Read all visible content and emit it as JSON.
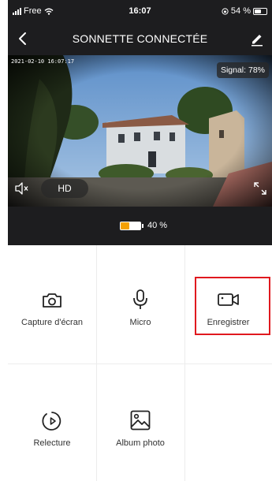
{
  "status_bar": {
    "carrier": "Free",
    "time": "16:07",
    "battery_percent": "54 %"
  },
  "header": {
    "title": "SONNETTE CONNECTÉE"
  },
  "video": {
    "timestamp": "2021-02-10 16:07:17",
    "signal": "Signal: 78%",
    "quality": "HD"
  },
  "battery": {
    "percent_label": "40 %",
    "level": 0.4,
    "fill_color": "#f5a000"
  },
  "actions": [
    {
      "label": "Capture d'écran",
      "icon": "camera-icon"
    },
    {
      "label": "Micro",
      "icon": "microphone-icon"
    },
    {
      "label": "Enregistrer",
      "icon": "video-camera-icon"
    },
    {
      "label": "Relecture",
      "icon": "playback-icon"
    },
    {
      "label": "Album photo",
      "icon": "photo-album-icon"
    }
  ],
  "colors": {
    "dark_bg": "#1d1d1f",
    "highlight": "#e0191e"
  }
}
